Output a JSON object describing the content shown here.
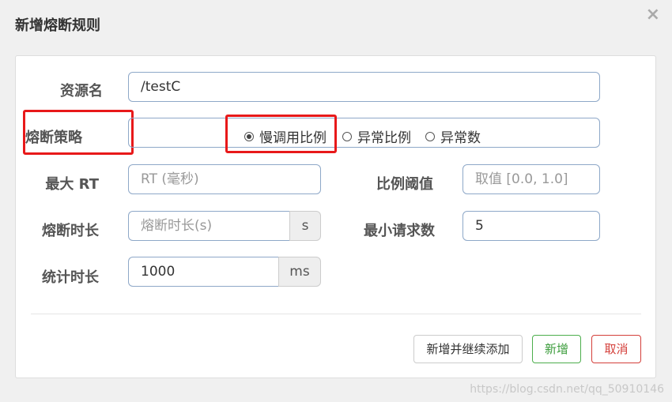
{
  "dialog": {
    "title": "新增熔断规则",
    "close_glyph": "×"
  },
  "form": {
    "resource": {
      "label": "资源名",
      "value": "/testC"
    },
    "strategy": {
      "label": "熔断策略",
      "options": [
        "慢调用比例",
        "异常比例",
        "异常数"
      ],
      "selected": "慢调用比例"
    },
    "max_rt": {
      "label": "最大 RT",
      "placeholder": "RT (毫秒)"
    },
    "ratio_threshold": {
      "label": "比例阈值",
      "placeholder": "取值 [0.0, 1.0]"
    },
    "break_duration": {
      "label": "熔断时长",
      "placeholder": "熔断时长(s)",
      "unit": "s"
    },
    "min_requests": {
      "label": "最小请求数",
      "value": "5"
    },
    "stat_duration": {
      "label": "统计时长",
      "value": "1000",
      "unit": "ms"
    }
  },
  "buttons": {
    "add_continue": "新增并继续添加",
    "add": "新增",
    "cancel": "取消"
  },
  "watermark": "https://blog.csdn.net/qq_50910146",
  "colors": {
    "highlight": "#e8191a",
    "success": "#3c9c3c",
    "danger": "#d43f3a"
  }
}
